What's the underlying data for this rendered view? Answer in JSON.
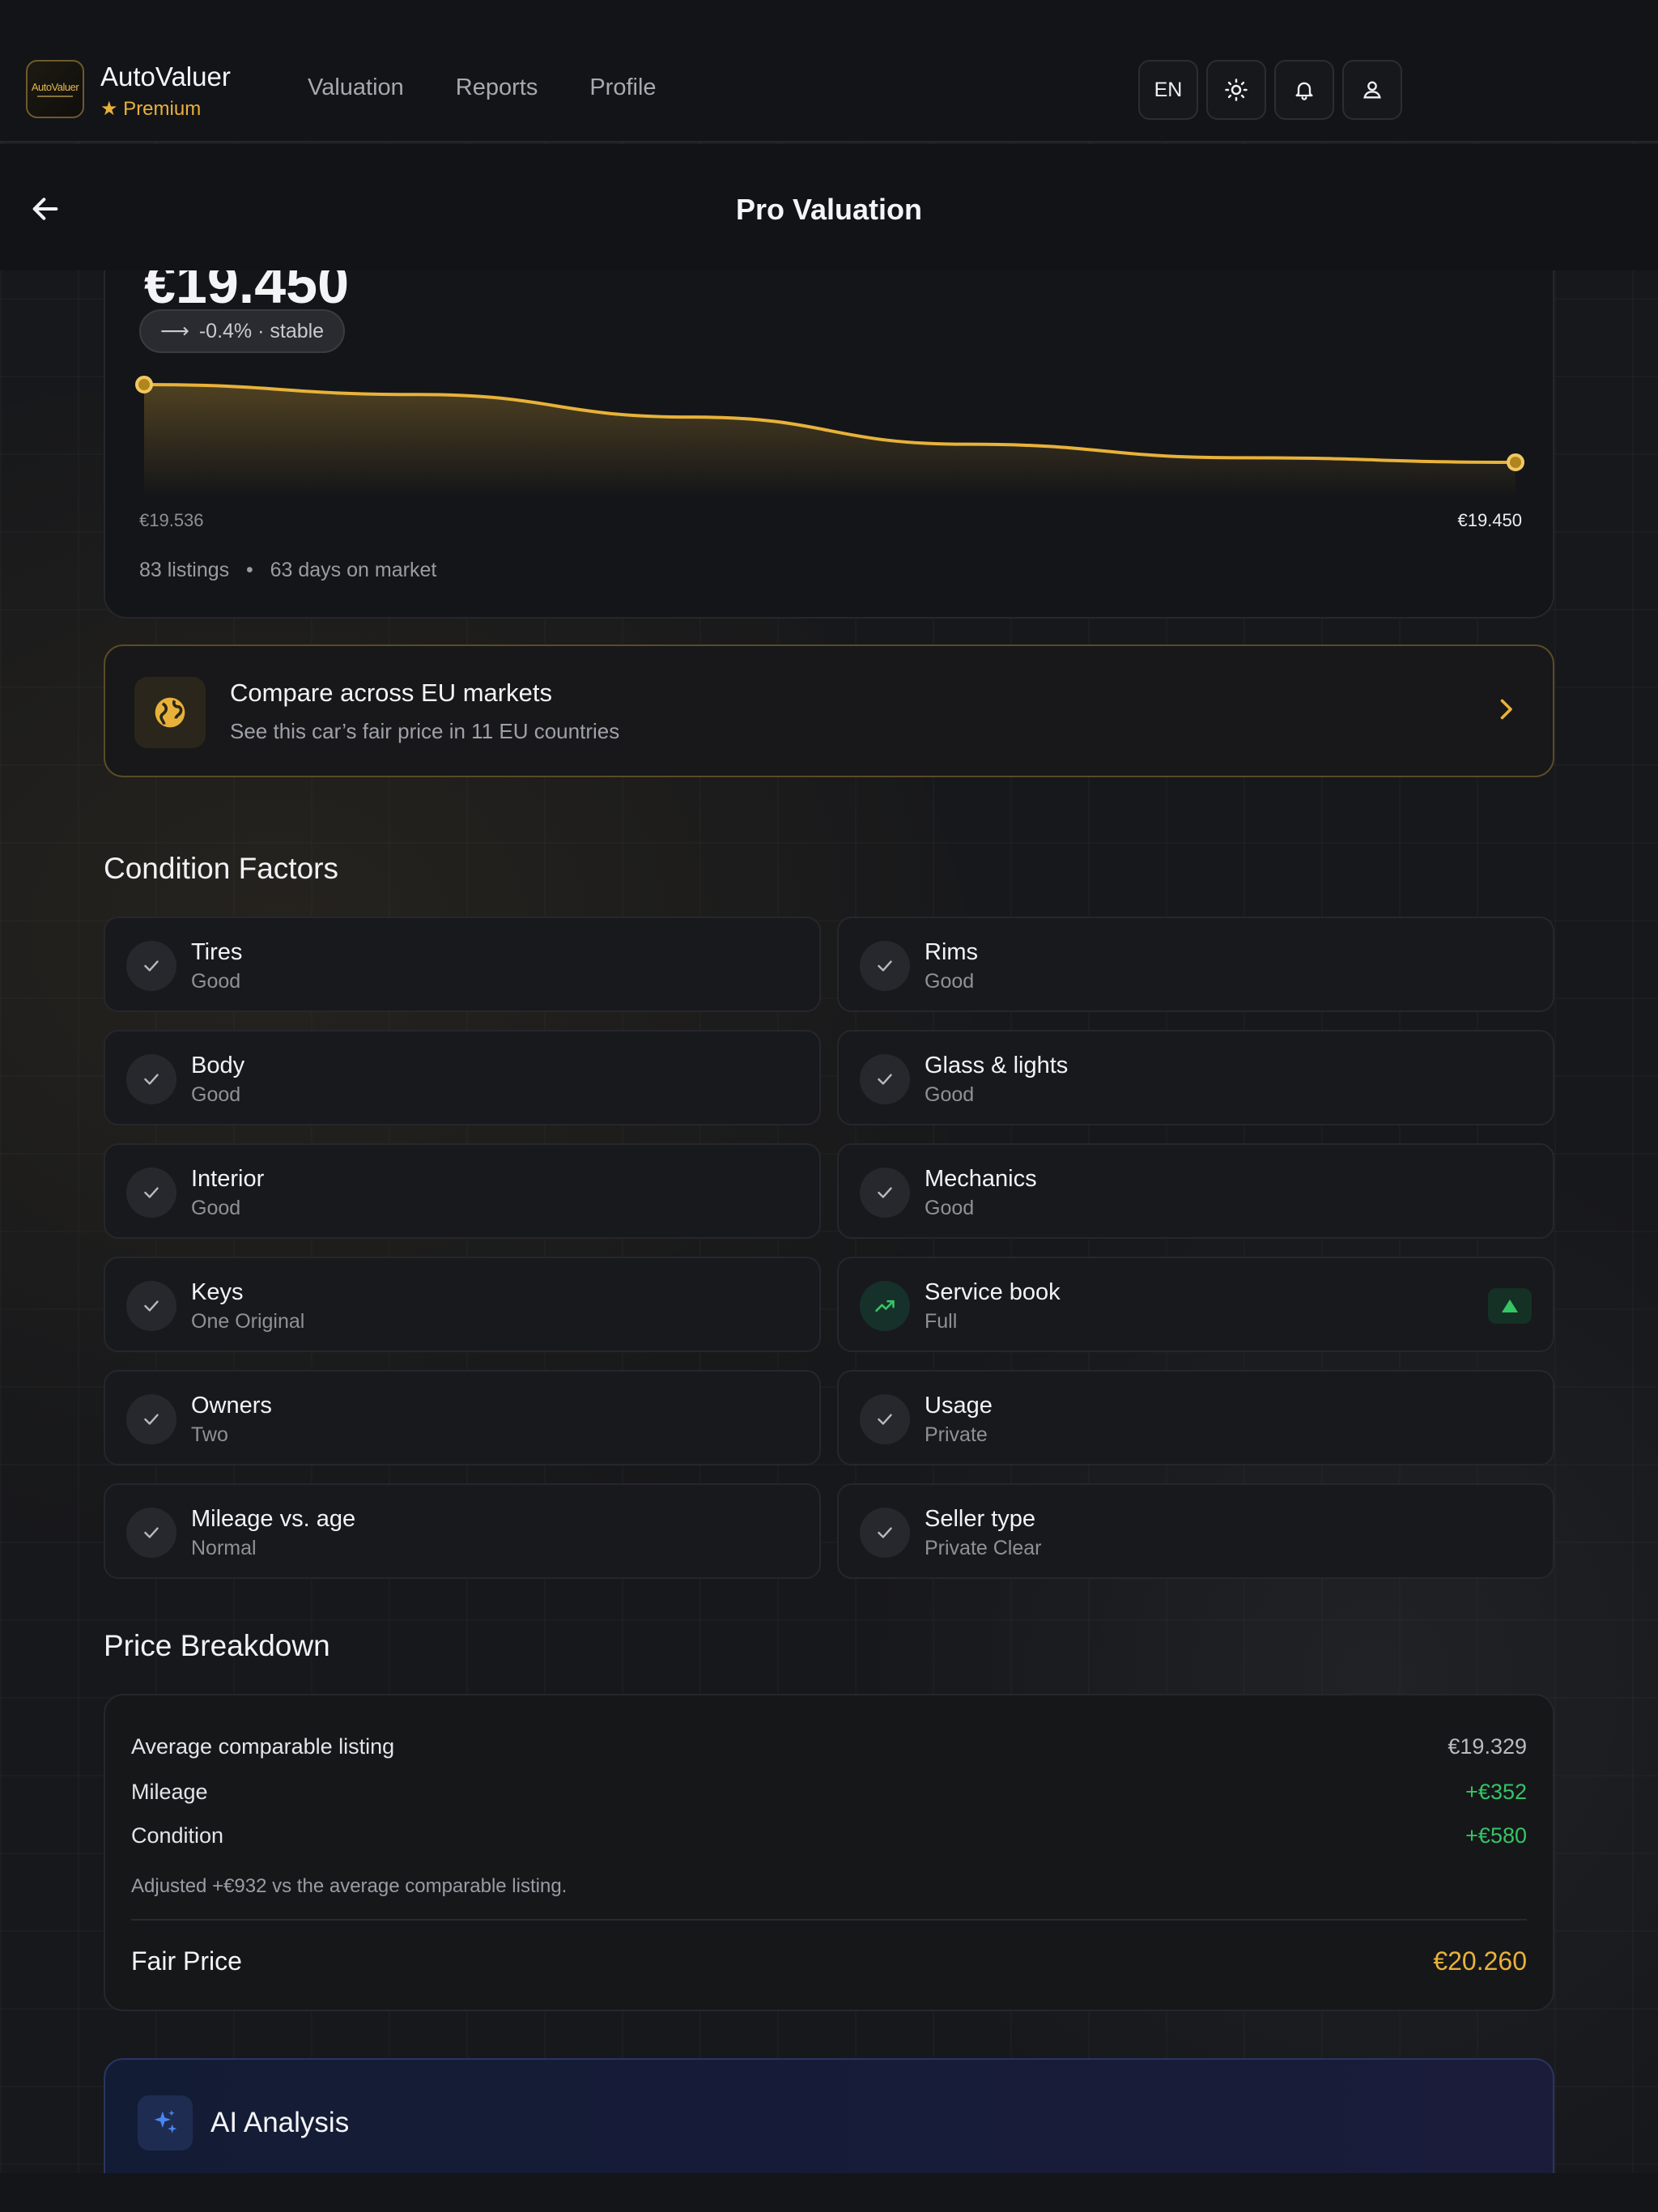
{
  "app": {
    "name": "AutoValuer",
    "tier": "★ Premium",
    "logo_text": "AutoValuer"
  },
  "nav": {
    "links": [
      "Valuation",
      "Reports",
      "Profile"
    ],
    "language": "EN"
  },
  "subheader": {
    "title": "Pro Valuation"
  },
  "trend": {
    "price_peek": "€19.450",
    "pill": "-0.4% · stable",
    "start_label": "€19.536",
    "end_label": "€19.450",
    "listings": "83 listings",
    "days": "63 days on market",
    "chart_data": {
      "type": "line",
      "series": [
        {
          "values": [
            19536,
            19525,
            19500,
            19470,
            19455,
            19450
          ]
        }
      ],
      "start_value": 19536,
      "end_value": 19450,
      "change_pct": -0.4
    }
  },
  "compare": {
    "title": "Compare across EU markets",
    "subtitle": "See this car’s fair price in 11 EU countries"
  },
  "condition": {
    "title": "Condition Factors",
    "items": [
      {
        "name": "Tires",
        "value": "Good"
      },
      {
        "name": "Rims",
        "value": "Good"
      },
      {
        "name": "Body",
        "value": "Good"
      },
      {
        "name": "Glass & lights",
        "value": "Good"
      },
      {
        "name": "Interior",
        "value": "Good"
      },
      {
        "name": "Mechanics",
        "value": "Good"
      },
      {
        "name": "Keys",
        "value": "One Original"
      },
      {
        "name": "Service book",
        "value": "Full"
      },
      {
        "name": "Owners",
        "value": "Two"
      },
      {
        "name": "Usage",
        "value": "Private"
      },
      {
        "name": "Mileage vs. age",
        "value": "Normal"
      },
      {
        "name": "Seller type",
        "value": "Private Clear"
      }
    ]
  },
  "breakdown": {
    "title": "Price Breakdown",
    "rows": [
      {
        "label": "Average comparable listing",
        "value": "€19.329"
      },
      {
        "label": "Mileage",
        "value": "+€352"
      },
      {
        "label": "Condition",
        "value": "+€580"
      }
    ],
    "note": "Adjusted +€932 vs the average comparable listing.",
    "fair_label": "Fair Price",
    "fair_value": "€20.260"
  },
  "ai": {
    "title": "AI Analysis"
  },
  "colors": {
    "accent_gold": "#e8b23a",
    "positive_green": "#35c466",
    "ai_blue": "#4a86f0"
  }
}
